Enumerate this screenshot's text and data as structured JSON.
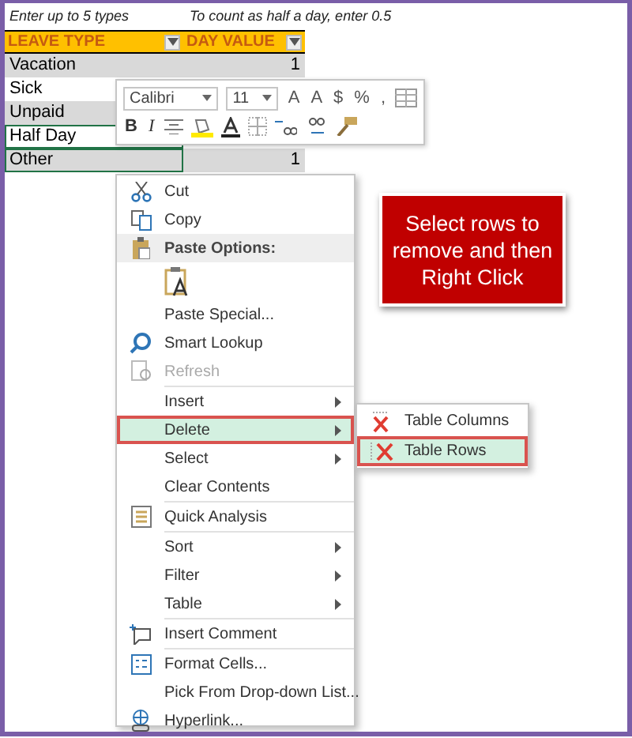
{
  "notes": [
    "Enter up to 5 types",
    "To count as half a day, enter 0.5"
  ],
  "table": {
    "columns": [
      "LEAVE TYPE",
      "DAY VALUE"
    ],
    "rows": [
      {
        "name": "Vacation",
        "value": "1",
        "selected": false
      },
      {
        "name": "Sick",
        "selected": false
      },
      {
        "name": "Unpaid",
        "selected": false
      },
      {
        "name": "Half Day",
        "selected": true
      },
      {
        "name": "Other",
        "value": "1",
        "selected": true
      }
    ]
  },
  "mini_toolbar": {
    "font": "Calibri",
    "size": "11",
    "grow": "A",
    "shrink": "A",
    "currency": "$",
    "percent": "%",
    "comma": ",",
    "bold": "B",
    "italic": "I"
  },
  "context_menu": [
    {
      "kind": "item",
      "label": "Cut"
    },
    {
      "kind": "item",
      "label": "Copy"
    },
    {
      "kind": "header",
      "label": "Paste Options:"
    },
    {
      "kind": "paste"
    },
    {
      "kind": "item",
      "label": "Paste Special..."
    },
    {
      "kind": "item",
      "label": "Smart Lookup"
    },
    {
      "kind": "item",
      "label": "Refresh",
      "disabled": true
    },
    {
      "kind": "submenu",
      "label": "Insert",
      "separator": true
    },
    {
      "kind": "submenu",
      "label": "Delete",
      "selected": true
    },
    {
      "kind": "submenu",
      "label": "Select"
    },
    {
      "kind": "item",
      "label": "Clear Contents"
    },
    {
      "kind": "item",
      "label": "Quick Analysis",
      "separator": true
    },
    {
      "kind": "submenu",
      "label": "Sort",
      "separator": true
    },
    {
      "kind": "submenu",
      "label": "Filter"
    },
    {
      "kind": "submenu",
      "label": "Table"
    },
    {
      "kind": "item",
      "label": "Insert Comment",
      "separator": true
    },
    {
      "kind": "item",
      "label": "Format Cells...",
      "separator": true
    },
    {
      "kind": "item",
      "label": "Pick From Drop-down List..."
    },
    {
      "kind": "item",
      "label": "Hyperlink..."
    }
  ],
  "submenu": [
    {
      "label": "Table Columns",
      "selected": false
    },
    {
      "label": "Table Rows",
      "selected": true
    }
  ],
  "callout": "Select rows to remove and then Right Click"
}
